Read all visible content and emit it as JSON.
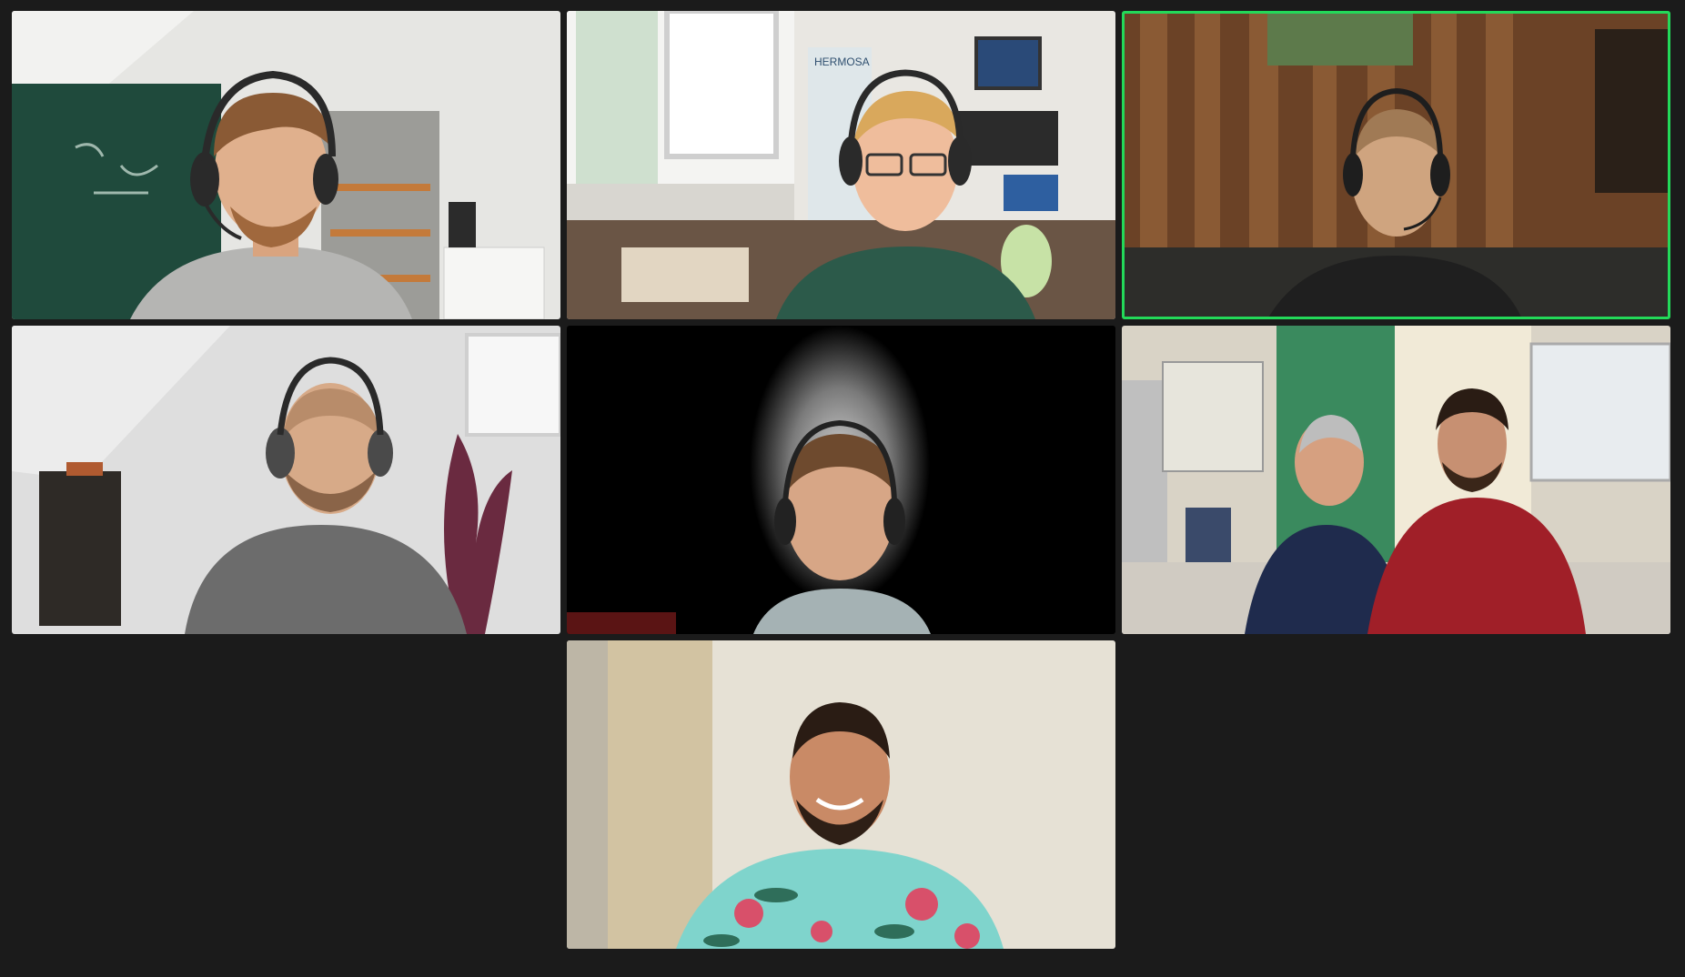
{
  "app": {
    "view": "gallery-view",
    "background_color": "#1b1b1b",
    "active_speaker_color": "#23d959"
  },
  "participants": [
    {
      "id": "p1",
      "active_speaker": false,
      "scene": "office-with-chalkboard-and-shelves",
      "headset": true
    },
    {
      "id": "p2",
      "active_speaker": false,
      "scene": "open-office-with-window",
      "headset": true,
      "poster_text": "HERMOSA"
    },
    {
      "id": "p3",
      "active_speaker": true,
      "scene": "wood-paneled-room",
      "headset": true
    },
    {
      "id": "p4",
      "active_speaker": false,
      "scene": "white-room-with-plant",
      "headset": true
    },
    {
      "id": "p5",
      "active_speaker": false,
      "scene": "blurred-background",
      "headset": true
    },
    {
      "id": "p6",
      "active_speaker": false,
      "scene": "room-with-green-door-two-people",
      "headset": false
    },
    {
      "id": "p7",
      "active_speaker": false,
      "scene": "plain-wall",
      "headset": false
    }
  ]
}
